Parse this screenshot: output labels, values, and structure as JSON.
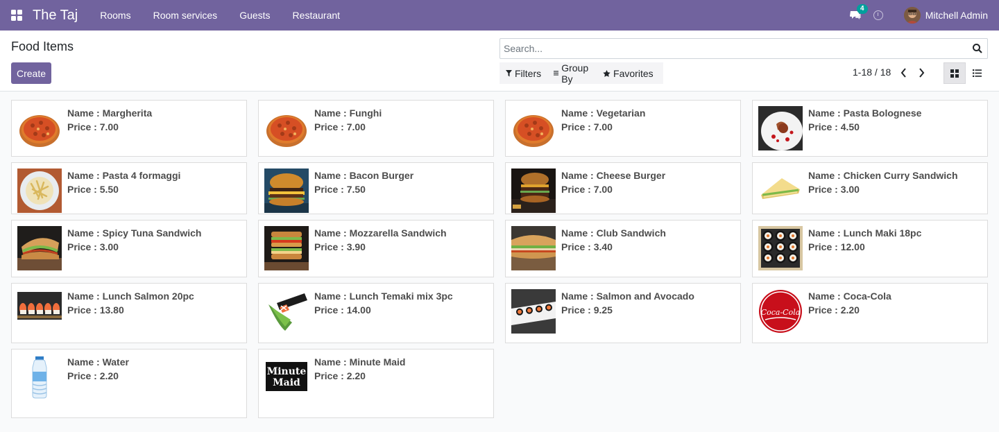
{
  "navbar": {
    "brand": "The Taj",
    "menu": [
      "Rooms",
      "Room services",
      "Guests",
      "Restaurant"
    ],
    "chat_badge": "4",
    "user_name": "Mitchell Admin"
  },
  "control_panel": {
    "title": "Food Items",
    "create_label": "Create",
    "search_placeholder": "Search...",
    "filters_label": "Filters",
    "groupby_label": "Group By",
    "favorites_label": "Favorites",
    "pager": "1-18 / 18"
  },
  "items": [
    {
      "name": "Name : Margherita",
      "price": "Price : 7.00",
      "icon": "pizza"
    },
    {
      "name": "Name : Funghi",
      "price": "Price : 7.00",
      "icon": "pizza"
    },
    {
      "name": "Name : Vegetarian",
      "price": "Price : 7.00",
      "icon": "pizza"
    },
    {
      "name": "Name : Pasta Bolognese",
      "price": "Price : 4.50",
      "icon": "pasta-plate"
    },
    {
      "name": "Name : Pasta 4 formaggi",
      "price": "Price : 5.50",
      "icon": "pasta-bowl"
    },
    {
      "name": "Name : Bacon Burger",
      "price": "Price : 7.50",
      "icon": "burger"
    },
    {
      "name": "Name : Cheese Burger",
      "price": "Price : 7.00",
      "icon": "burger-dark"
    },
    {
      "name": "Name : Chicken Curry Sandwich",
      "price": "Price : 3.00",
      "icon": "sandwich-triangle"
    },
    {
      "name": "Name : Spicy Tuna Sandwich",
      "price": "Price : 3.00",
      "icon": "sandwich"
    },
    {
      "name": "Name : Mozzarella Sandwich",
      "price": "Price : 3.90",
      "icon": "sandwich-stack"
    },
    {
      "name": "Name : Club Sandwich",
      "price": "Price : 3.40",
      "icon": "sandwich-baguette"
    },
    {
      "name": "Name : Lunch Maki 18pc",
      "price": "Price : 12.00",
      "icon": "maki"
    },
    {
      "name": "Name : Lunch Salmon 20pc",
      "price": "Price : 13.80",
      "icon": "sushi-row"
    },
    {
      "name": "Name : Lunch Temaki mix 3pc",
      "price": "Price : 14.00",
      "icon": "temaki"
    },
    {
      "name": "Name : Salmon and Avocado",
      "price": "Price : 9.25",
      "icon": "sushi-plate"
    },
    {
      "name": "Name : Coca-Cola",
      "price": "Price : 2.20",
      "icon": "coca-cola",
      "logo_text": "Coca-Cola"
    },
    {
      "name": "Name : Water",
      "price": "Price : 2.20",
      "icon": "water-bottle"
    },
    {
      "name": "Name : Minute Maid",
      "price": "Price : 2.20",
      "icon": "minute-maid",
      "logo_text": "Minute Maid"
    }
  ]
}
